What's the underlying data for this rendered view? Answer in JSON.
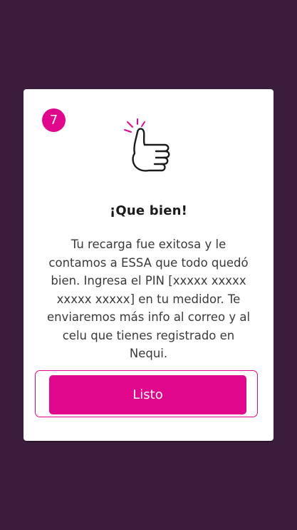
{
  "dialog": {
    "step_number": "7",
    "illustration_icon": "thumbs-up-icon",
    "title": "¡Que bien!",
    "message": "Tu recarga fue exitosa y le contamos a ESSA que todo quedó bien. Ingresa el PIN [xxxxx xxxxx xxxxx xxxxx] en tu medidor. Te enviaremos más info al correo y al celu que tienes registrado en Nequi.",
    "button_label": "Listo"
  },
  "colors": {
    "background": "#3a1c3c",
    "accent": "#e0078c",
    "card": "#ffffff"
  }
}
